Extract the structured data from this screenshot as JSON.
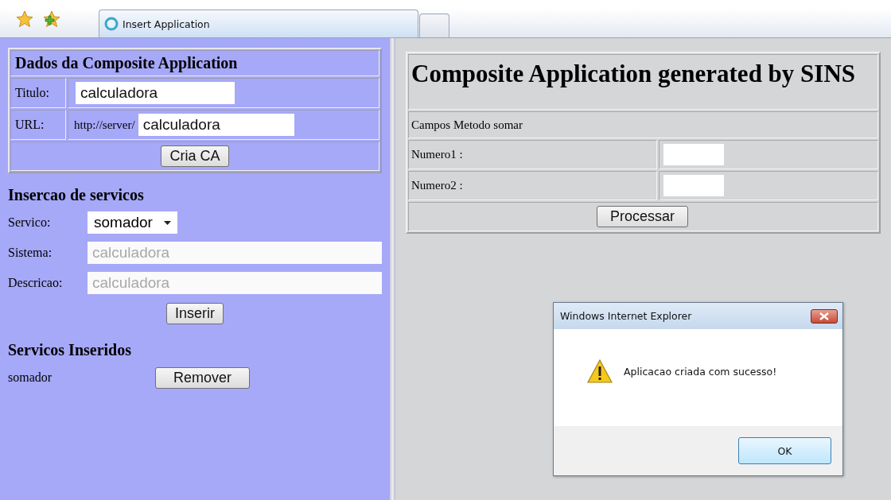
{
  "browser": {
    "tabs": [
      {
        "title": "Insert Application",
        "selected": true
      }
    ]
  },
  "left": {
    "composite_form": {
      "heading": "Dados da Composite Application",
      "titulo": {
        "label": "Titulo:",
        "value": "calculadora"
      },
      "url": {
        "label": "URL:",
        "prefix": "http://server/",
        "value": "calculadora"
      },
      "button": "Cria CA"
    },
    "insercao": {
      "heading": "Insercao de servicos",
      "servico": {
        "label": "Servico:",
        "value": "somador"
      },
      "fields": [
        {
          "label": "Sistema:",
          "placeholder": "calculadora"
        },
        {
          "label": "Descricao:",
          "placeholder": "calculadora"
        }
      ],
      "button": "Inserir"
    },
    "inseridos": {
      "heading": "Servicos Inseridos",
      "items": [
        {
          "name": "somador",
          "button": "Remover"
        }
      ]
    }
  },
  "right": {
    "title": "Composite Application generated by SINS",
    "method_heading": "Campos Metodo somar",
    "fields": [
      {
        "label": "Numero1 :"
      },
      {
        "label": "Numero2 :"
      }
    ],
    "button": "Processar"
  },
  "dialog": {
    "title": "Windows Internet Explorer",
    "message": "Aplicacao criada com sucesso!",
    "button": "OK"
  }
}
